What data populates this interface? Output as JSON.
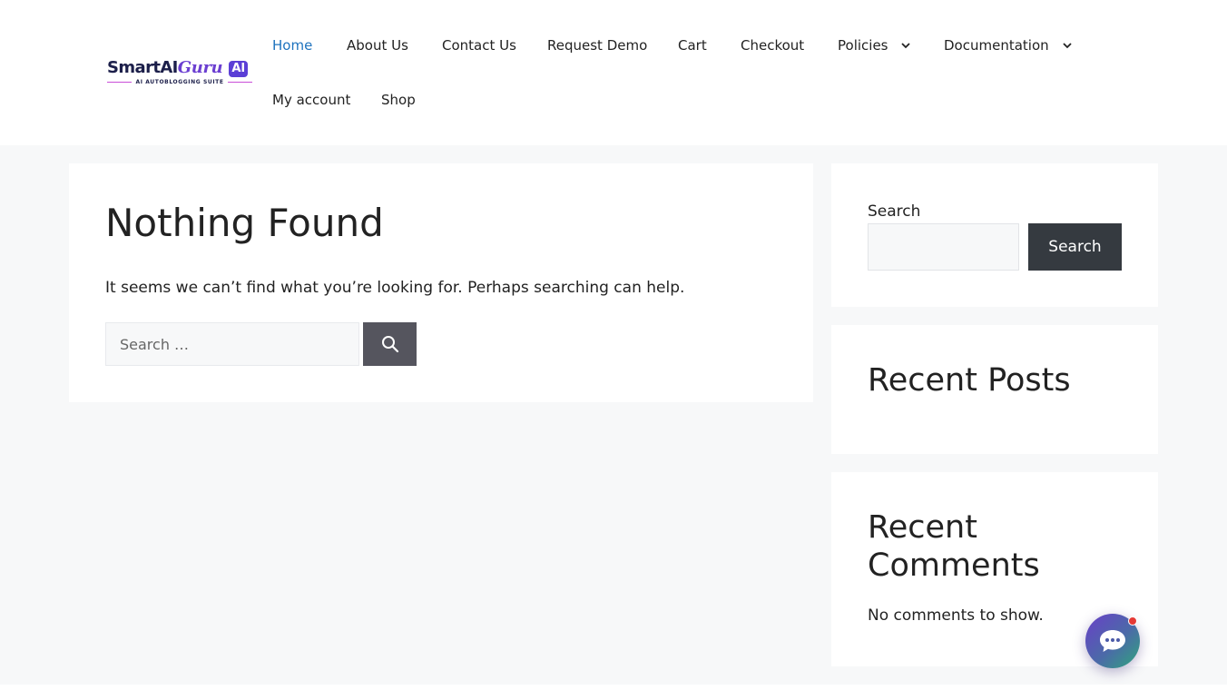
{
  "logo": {
    "name_part1": "SmartAI",
    "name_part2": "Guru",
    "badge": "AI",
    "tagline": "AI AUTOBLOGGING SUITE"
  },
  "nav": {
    "items": [
      {
        "label": "Home"
      },
      {
        "label": "About Us"
      },
      {
        "label": "Contact Us"
      },
      {
        "label": "Request Demo"
      },
      {
        "label": "Cart"
      },
      {
        "label": "Checkout"
      },
      {
        "label": "Policies"
      },
      {
        "label": "Documentation"
      },
      {
        "label": "My account"
      },
      {
        "label": "Shop"
      }
    ],
    "active": "Home",
    "accent_color": "#1e73be"
  },
  "main": {
    "title": "Nothing Found",
    "message": "It seems we can’t find what you’re looking for. Perhaps searching can help.",
    "search_placeholder": "Search …",
    "search_icon": "search-icon"
  },
  "sidebar": {
    "search_widget": {
      "label": "Search",
      "button_label": "Search"
    },
    "recent_posts": {
      "title": "Recent Posts"
    },
    "recent_comments": {
      "title": "Recent Comments",
      "empty_text": "No comments to show."
    }
  },
  "chat": {
    "icon": "chat-bubble-icon",
    "notification_color": "#e53935"
  }
}
